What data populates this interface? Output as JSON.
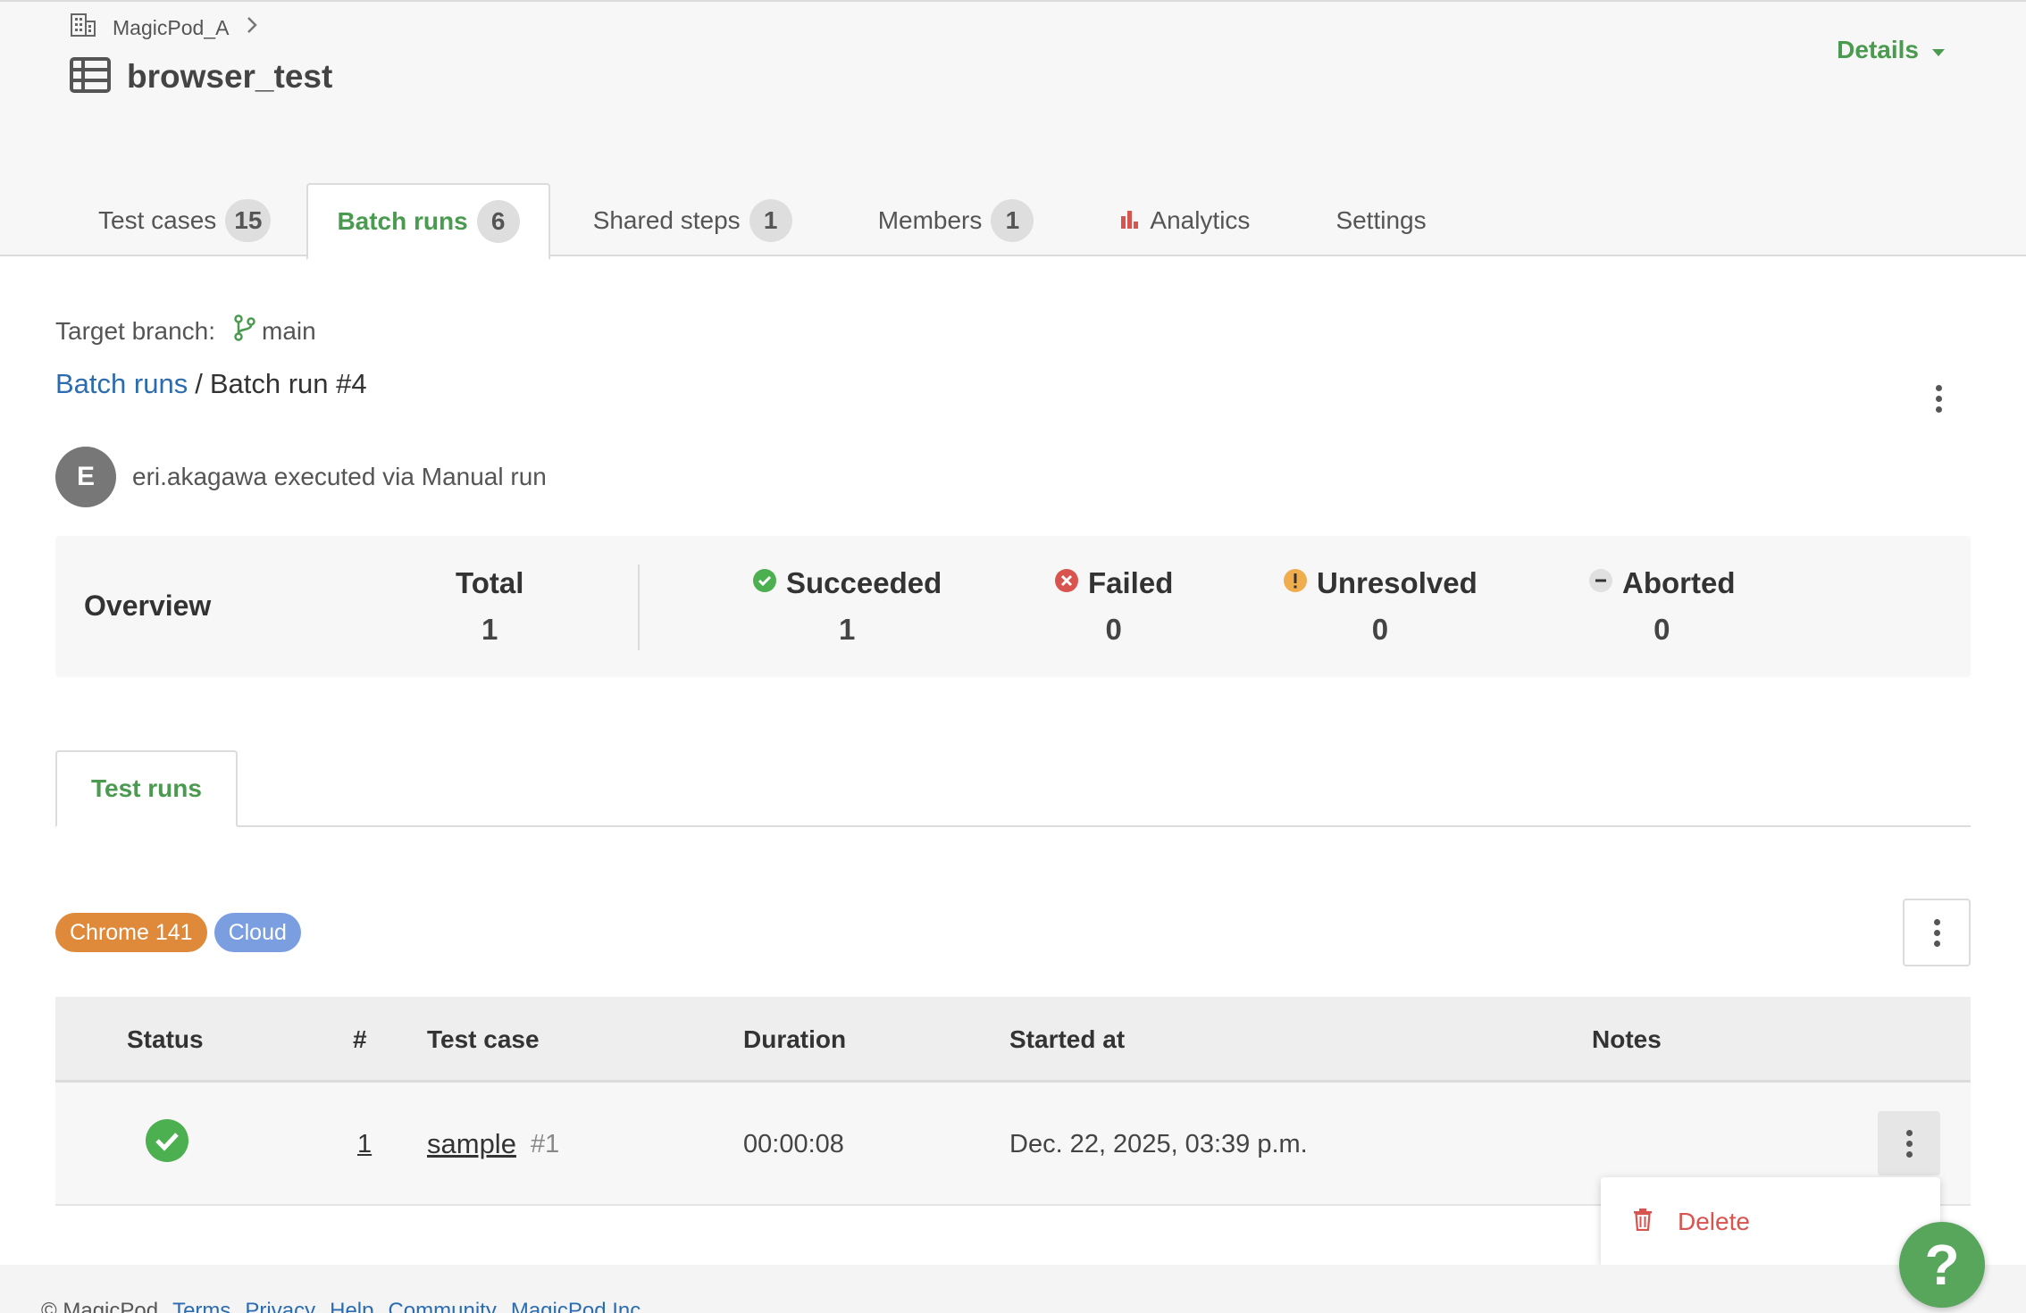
{
  "header": {
    "org_name": "MagicPod_A",
    "project_name": "browser_test",
    "details_label": "Details"
  },
  "tabs": [
    {
      "label": "Test cases",
      "count": "15"
    },
    {
      "label": "Batch runs",
      "count": "6"
    },
    {
      "label": "Shared steps",
      "count": "1"
    },
    {
      "label": "Members",
      "count": "1"
    },
    {
      "label": "Analytics"
    },
    {
      "label": "Settings"
    }
  ],
  "branch": {
    "label": "Target branch:",
    "value": "main"
  },
  "breadcrumb": {
    "parent": "Batch runs",
    "separator": "/",
    "current": "Batch run #4"
  },
  "executor": {
    "initial": "E",
    "text": "eri.akagawa executed via Manual run"
  },
  "overview": {
    "title": "Overview",
    "total": {
      "label": "Total",
      "value": "1"
    },
    "succeeded": {
      "label": "Succeeded",
      "value": "1"
    },
    "failed": {
      "label": "Failed",
      "value": "0"
    },
    "unresolved": {
      "label": "Unresolved",
      "value": "0"
    },
    "aborted": {
      "label": "Aborted",
      "value": "0"
    }
  },
  "subtab": {
    "label": "Test runs"
  },
  "tags": [
    {
      "label": "Chrome 141",
      "color": "#de8a3a"
    },
    {
      "label": "Cloud",
      "color": "#7a9ee0"
    }
  ],
  "table": {
    "headers": {
      "status": "Status",
      "num": "#",
      "test_case": "Test case",
      "duration": "Duration",
      "started": "Started at",
      "notes": "Notes"
    },
    "rows": [
      {
        "status": "succeeded",
        "num": "1",
        "test_case": "sample",
        "case_no": "#1",
        "duration": "00:00:08",
        "started": "Dec. 22, 2025, 03:39 p.m.",
        "notes": ""
      }
    ]
  },
  "row_menu": {
    "delete_label": "Delete"
  },
  "footer": {
    "copyright": "© MagicPod",
    "links": [
      "Terms",
      "Privacy",
      "Help",
      "Community",
      "MagicPod Inc."
    ]
  },
  "help_fab": {
    "label": "?"
  },
  "colors": {
    "accent": "#4a9a4f",
    "link": "#2b6cb0",
    "success": "#4caf50",
    "danger": "#d9534f",
    "warning": "#f0ad4e"
  }
}
